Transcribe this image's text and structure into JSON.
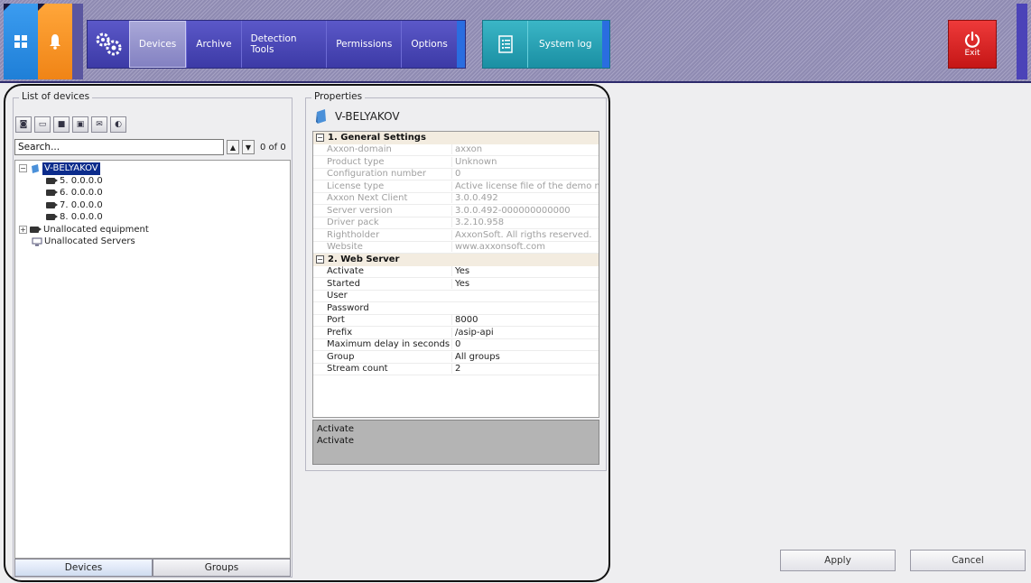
{
  "menu": {
    "items": [
      "Devices",
      "Archive",
      "Detection Tools",
      "Permissions",
      "Options"
    ],
    "syslog_label": "System log",
    "exit_label": "Exit"
  },
  "devices_panel": {
    "title": "List of devices",
    "search_placeholder": "Search...",
    "count_text": "0 of 0",
    "tree": {
      "server": "V-BELYAKOV",
      "cameras": [
        "5. 0.0.0.0",
        "6. 0.0.0.0",
        "7. 0.0.0.0",
        "8. 0.0.0.0"
      ],
      "unallocated_equipment": "Unallocated equipment",
      "unallocated_servers": "Unallocated Servers"
    },
    "tabs": [
      "Devices",
      "Groups"
    ]
  },
  "properties": {
    "title": "Properties",
    "object_name": "V-BELYAKOV",
    "sections": [
      {
        "title": "1. General Settings",
        "rows": [
          {
            "name": "Axxon-domain",
            "value": "axxon"
          },
          {
            "name": "Product type",
            "value": "Unknown"
          },
          {
            "name": "Configuration number",
            "value": "0"
          },
          {
            "name": "License type",
            "value": "Active license file of the demo mo"
          },
          {
            "name": "Axxon Next Client",
            "value": "3.0.0.492"
          },
          {
            "name": "Server version",
            "value": "3.0.0.492-000000000000"
          },
          {
            "name": "Driver pack",
            "value": "3.2.10.958"
          },
          {
            "name": "Rightholder",
            "value": "AxxonSoft. All rigths reserved."
          },
          {
            "name": "Website",
            "value": "www.axxonsoft.com"
          }
        ]
      },
      {
        "title": "2. Web Server",
        "rows": [
          {
            "name": "Activate",
            "value": "Yes"
          },
          {
            "name": "Started",
            "value": "Yes"
          },
          {
            "name": "User",
            "value": ""
          },
          {
            "name": "Password",
            "value": ""
          },
          {
            "name": "Port",
            "value": "8000"
          },
          {
            "name": "Prefix",
            "value": "/asip-api"
          },
          {
            "name": "Maximum delay in seconds",
            "value": "0"
          },
          {
            "name": "Group",
            "value": "All groups"
          },
          {
            "name": "Stream count",
            "value": "2"
          }
        ]
      }
    ],
    "description": {
      "title": "Activate",
      "text": "Activate"
    }
  },
  "buttons": {
    "apply": "Apply",
    "cancel": "Cancel"
  },
  "colors": {
    "accent": "#3c3aa6",
    "exit": "#d41f1f",
    "selection": "#0c2c8c"
  }
}
